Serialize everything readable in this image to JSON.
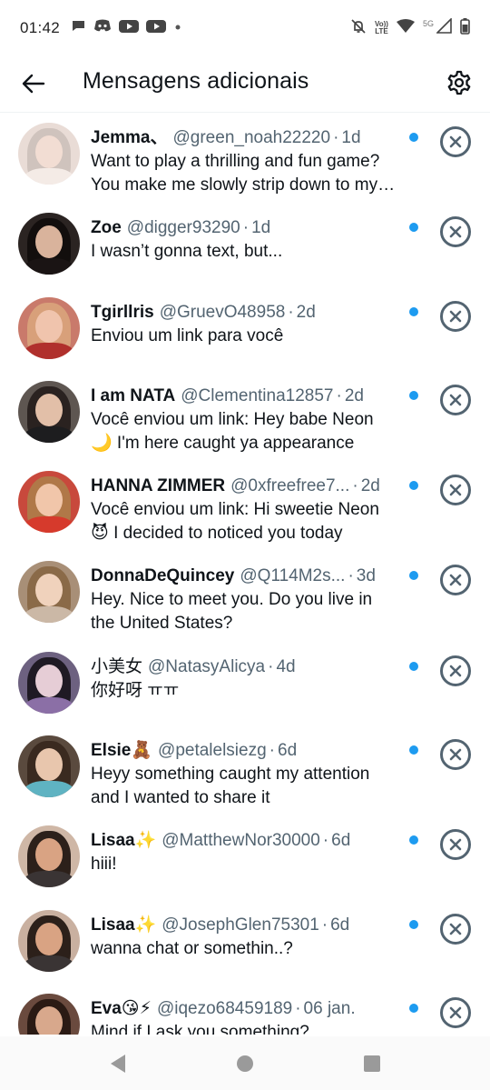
{
  "status_bar": {
    "time": "01:42",
    "left_icons": [
      "chat-bubble-icon",
      "discord-icon",
      "youtube-icon",
      "youtube-icon",
      "dot-icon"
    ],
    "lte_label_top": "Vo))",
    "lte_label_bottom": "LTE",
    "network_label": "5G"
  },
  "header": {
    "title": "Mensagens adicionais"
  },
  "conversations": [
    {
      "name": "Jemma、",
      "handle": "@green_noah22220",
      "sep": "·",
      "time": "1d",
      "message": "Want to play a thrilling and fun game? You make me slowly strip down to my birthday suit...",
      "unread": true
    },
    {
      "name": "Zoe",
      "handle": "@digger93290",
      "sep": "·",
      "time": "1d",
      "message": "I wasn’t gonna text, but...",
      "unread": true
    },
    {
      "name": "Tgirllris",
      "handle": "@GruevO48958",
      "sep": "·",
      "time": "2d",
      "message": "Enviou um link para você",
      "unread": true
    },
    {
      "name": "I am NATA",
      "handle": "@Clementina12857",
      "sep": "·",
      "time": "2d",
      "message": "Você enviou um link: Hey babe Neon 🌙 I'm here caught ya appearance",
      "unread": true
    },
    {
      "name": "HANNA ZIMMER",
      "handle": "@0xfreefree7...",
      "sep": "·",
      "time": "2d",
      "message": "Você enviou um link: Hi sweetie Neon 😈 I decided to noticed you today",
      "unread": true
    },
    {
      "name": "DonnaDeQuincey",
      "handle": "@Q114M2s...",
      "sep": "·",
      "time": "3d",
      "message": "Hey. Nice to meet you. Do you live in the United States?",
      "unread": true
    },
    {
      "name": "小美女",
      "handle": "@NatasyAlicya",
      "sep": "·",
      "time": "4d",
      "message": "你好呀 ㅠㅠ",
      "unread": true
    },
    {
      "name": "Elsie🧸",
      "handle": "@petalelsiezg",
      "sep": "·",
      "time": "6d",
      "message": "Heyy something caught my attention and I wanted to share it",
      "unread": true
    },
    {
      "name": "Lisaa✨",
      "handle": "@MatthewNor30000",
      "sep": "·",
      "time": "6d",
      "message": "hiii!",
      "unread": true
    },
    {
      "name": "Lisaa✨",
      "handle": "@JosephGlen75301",
      "sep": "·",
      "time": "6d",
      "message": "wanna chat or somethin..?",
      "unread": true
    },
    {
      "name": "Eva😘⚡",
      "handle": "@iqezo68459189",
      "sep": "·",
      "time": "06 jan.",
      "message": "Mind if I ask you something?",
      "unread": true
    }
  ],
  "colors": {
    "accent": "#1d9bf0",
    "text": "#0f1419",
    "secondary": "#536471"
  }
}
